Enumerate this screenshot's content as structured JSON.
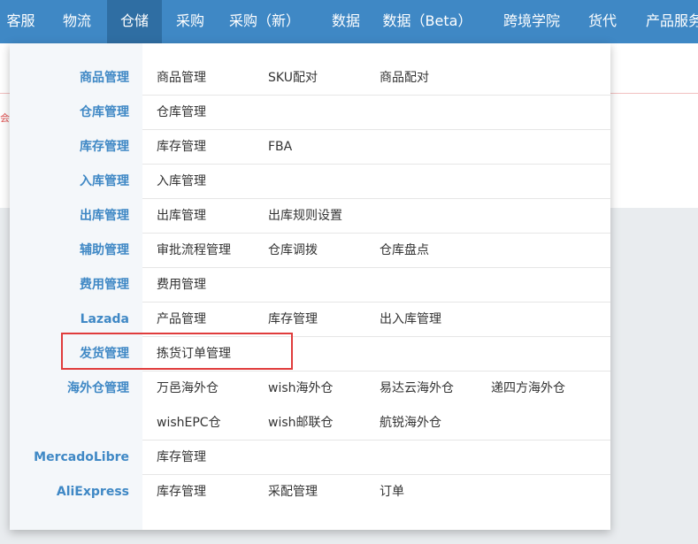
{
  "nav": {
    "items": [
      {
        "label": "客服"
      },
      {
        "label": "物流"
      },
      {
        "label": "仓储"
      },
      {
        "label": "采购"
      },
      {
        "label": "采购（新）"
      },
      {
        "label": "数据"
      },
      {
        "label": "数据（Beta）"
      },
      {
        "label": "跨境学院"
      },
      {
        "label": "货代"
      },
      {
        "label": "产品服务"
      }
    ],
    "active": "仓储"
  },
  "background": {
    "fragment": "会"
  },
  "menu": {
    "rows": [
      {
        "category": "商品管理",
        "items": [
          "商品管理",
          "SKU配对",
          "商品配对"
        ]
      },
      {
        "category": "仓库管理",
        "items": [
          "仓库管理"
        ]
      },
      {
        "category": "库存管理",
        "items": [
          "库存管理",
          "FBA"
        ]
      },
      {
        "category": "入库管理",
        "items": [
          "入库管理"
        ]
      },
      {
        "category": "出库管理",
        "items": [
          "出库管理",
          "出库规则设置"
        ]
      },
      {
        "category": "辅助管理",
        "items": [
          "审批流程管理",
          "仓库调拨",
          "仓库盘点"
        ]
      },
      {
        "category": "费用管理",
        "items": [
          "费用管理"
        ]
      },
      {
        "category": "Lazada",
        "items": [
          "产品管理",
          "库存管理",
          "出入库管理"
        ]
      },
      {
        "category": "发货管理",
        "items": [
          "拣货订单管理"
        ]
      },
      {
        "category": "海外仓管理",
        "items": [
          "万邑海外仓",
          "wish海外仓",
          "易达云海外仓",
          "递四方海外仓"
        ]
      },
      {
        "category": "",
        "items": [
          "wishEPC仓",
          "wish邮联仓",
          "航锐海外仓"
        ]
      },
      {
        "category": "MercadoLibre",
        "items": [
          "库存管理"
        ]
      },
      {
        "category": "AliExpress",
        "items": [
          "库存管理",
          "采配管理",
          "订单"
        ]
      }
    ]
  },
  "colors": {
    "nav_bg": "#3f88c5",
    "nav_active": "#2f6ea3",
    "category_text": "#3f88c5",
    "highlight_border": "#e03c3c"
  }
}
